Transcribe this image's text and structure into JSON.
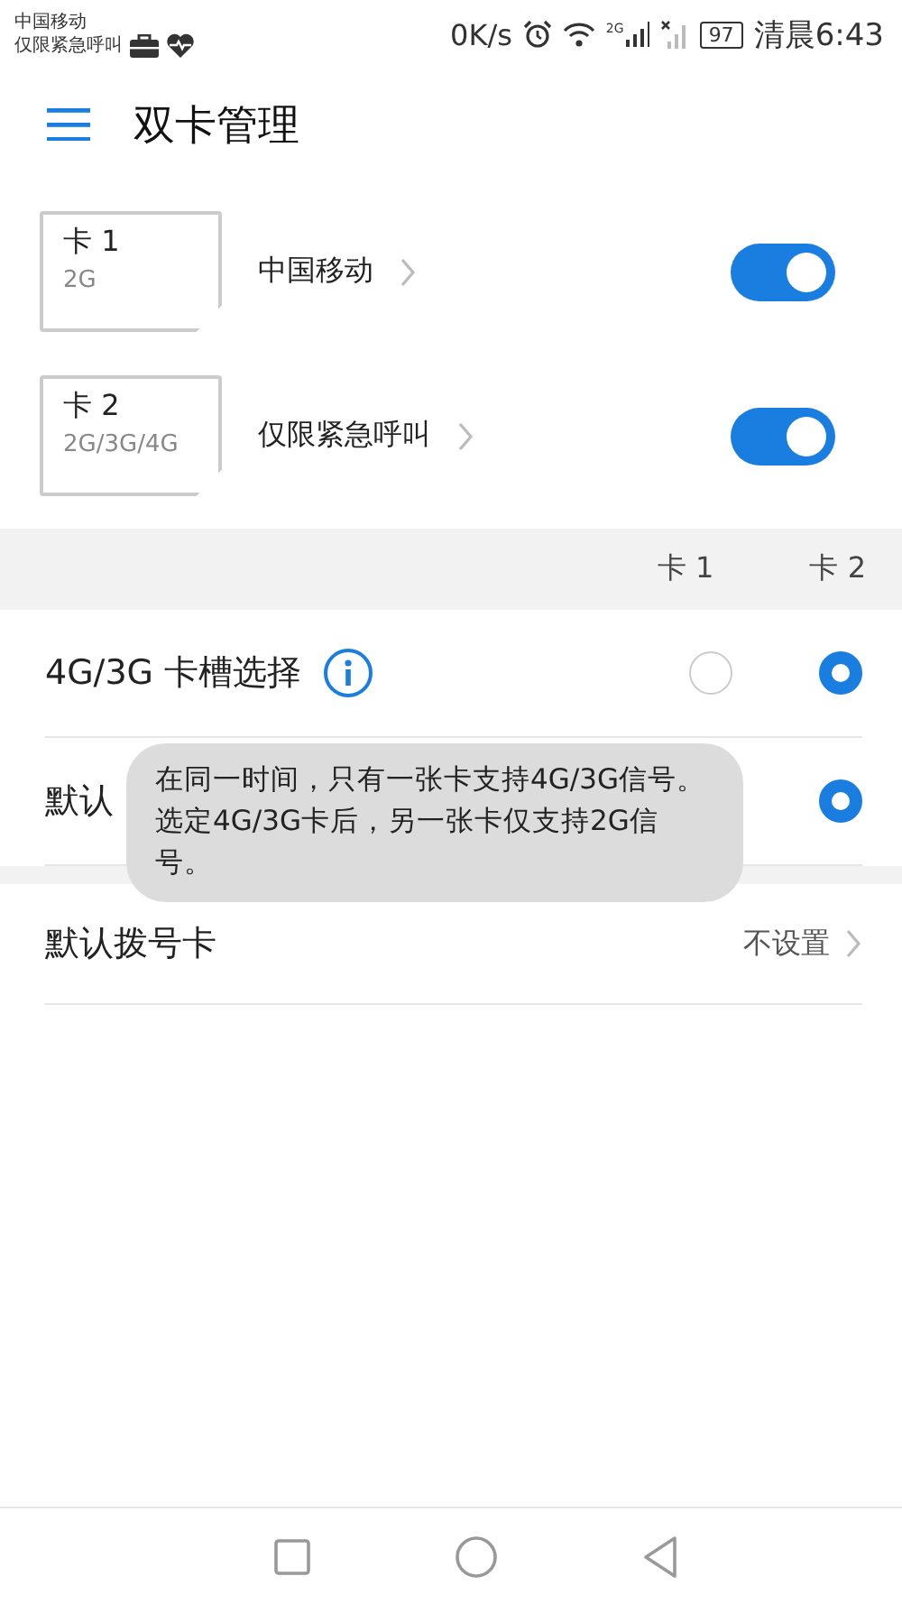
{
  "status_bar": {
    "carriers": [
      "中国移动",
      "仅限紧急呼叫"
    ],
    "speed": "0K/s",
    "signal_tag": "2G",
    "battery": "97",
    "time": "清晨6:43"
  },
  "header": {
    "title": "双卡管理"
  },
  "sims": [
    {
      "name": "卡 1",
      "network": "2G",
      "carrier": "中国移动",
      "on": true
    },
    {
      "name": "卡 2",
      "network": "2G/3G/4G",
      "carrier": "仅限紧急呼叫",
      "on": true
    }
  ],
  "columns": [
    "卡 1",
    "卡 2"
  ],
  "rows": [
    {
      "label": "4G/3G 卡槽选择",
      "info": true,
      "options": [
        {
          "selected": false
        },
        {
          "selected": true
        }
      ]
    },
    {
      "label": "默认",
      "info": false,
      "options": [
        {
          "selected": true
        }
      ]
    }
  ],
  "tooltip": "在同一时间，只有一张卡支持4G/3G信号。选定4G/3G卡后，另一张卡仅支持2G信号。",
  "dial": {
    "label": "默认拨号卡",
    "value": "不设置"
  }
}
